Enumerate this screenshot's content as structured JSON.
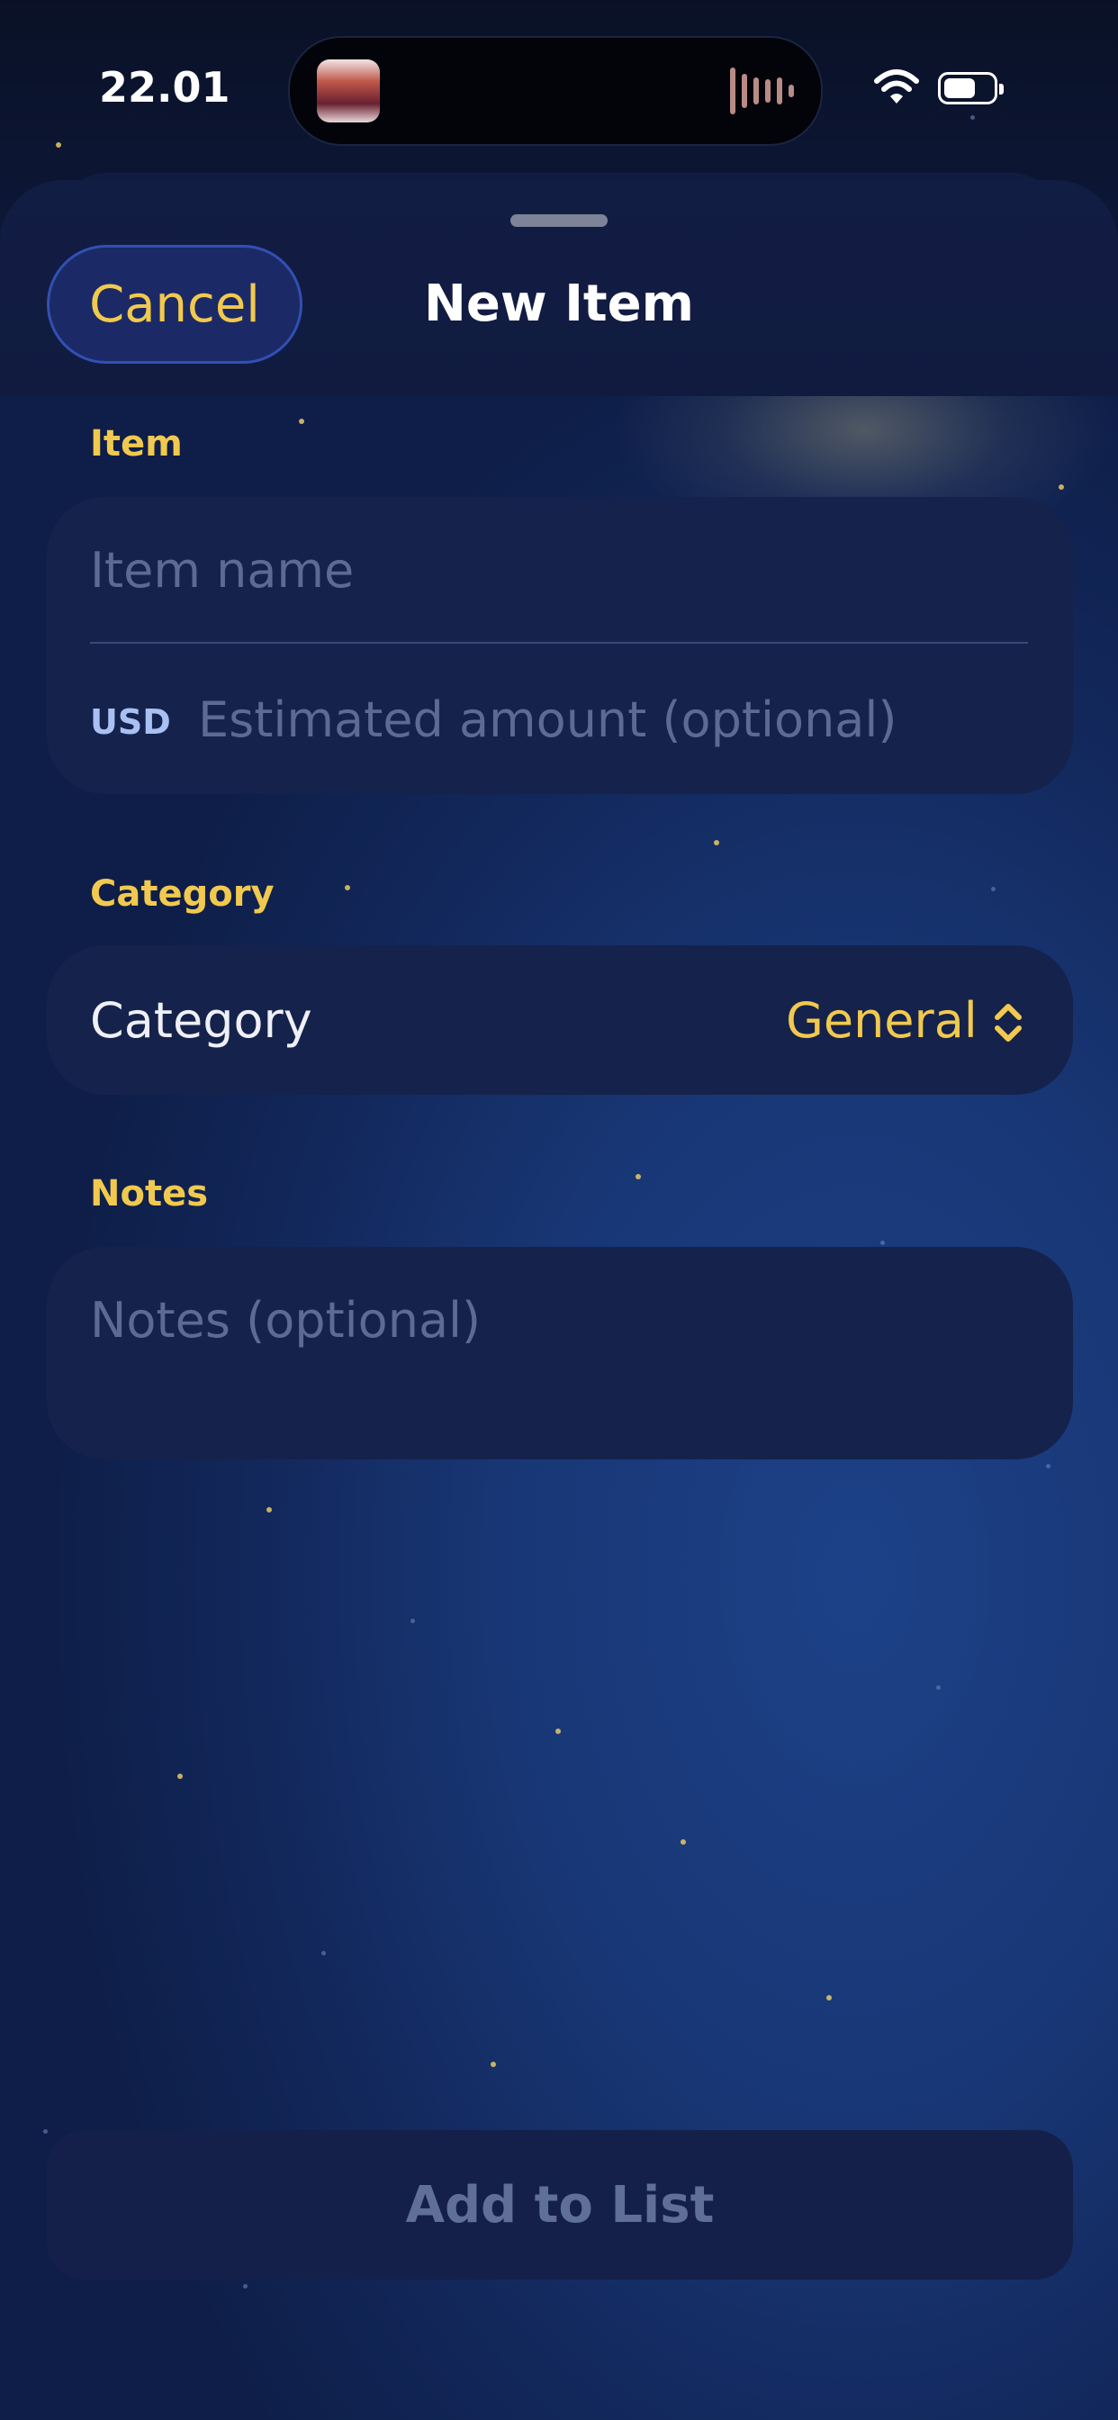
{
  "status_bar": {
    "time": "22.01"
  },
  "sheet": {
    "title": "New Item",
    "cancel_label": "Cancel"
  },
  "item_section": {
    "label": "Item",
    "name_placeholder": "Item name",
    "currency": "USD",
    "amount_placeholder": "Estimated amount (optional)"
  },
  "category_section": {
    "label": "Category",
    "row_label": "Category",
    "selected": "General"
  },
  "notes_section": {
    "label": "Notes",
    "placeholder": "Notes (optional)"
  },
  "footer": {
    "add_label": "Add to List"
  },
  "colors": {
    "accent": "#f1c94e",
    "background": "#183674",
    "card": "#15224b",
    "placeholder": "#5b6b92"
  },
  "icons": [
    "wifi-icon",
    "battery-icon",
    "grabber-handle",
    "chevron-up-down-icon"
  ]
}
